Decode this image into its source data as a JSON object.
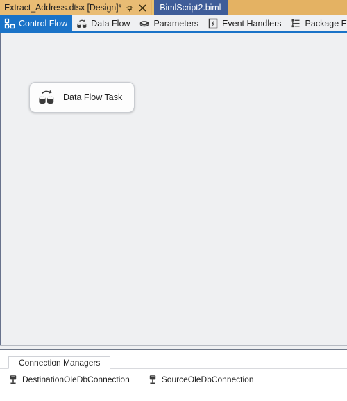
{
  "window": {
    "document_tabs": [
      {
        "label": "Extract_Address.dtsx [Design]*",
        "state": "active",
        "pin_icon": "pin-icon",
        "close_icon": "close-icon"
      },
      {
        "label": "BimlScript2.biml",
        "state": "inactive"
      }
    ]
  },
  "designer": {
    "tabs": [
      {
        "label": "Control Flow",
        "icon": "control-flow-icon",
        "selected": true
      },
      {
        "label": "Data Flow",
        "icon": "data-flow-icon",
        "selected": false
      },
      {
        "label": "Parameters",
        "icon": "parameters-icon",
        "selected": false
      },
      {
        "label": "Event Handlers",
        "icon": "event-handlers-icon",
        "selected": false
      },
      {
        "label": "Package Explorer",
        "icon": "package-explorer-icon",
        "selected": false
      }
    ],
    "accent_color": "#1a73c8",
    "canvas_color": "#eff0f2"
  },
  "canvas": {
    "tasks": [
      {
        "label": "Data Flow Task",
        "icon": "data-flow-task-icon"
      }
    ]
  },
  "connection_managers": {
    "tab_label": "Connection Managers",
    "items": [
      {
        "label": "DestinationOleDbConnection",
        "icon": "connection-icon"
      },
      {
        "label": "SourceOleDbConnection",
        "icon": "connection-icon"
      }
    ]
  }
}
